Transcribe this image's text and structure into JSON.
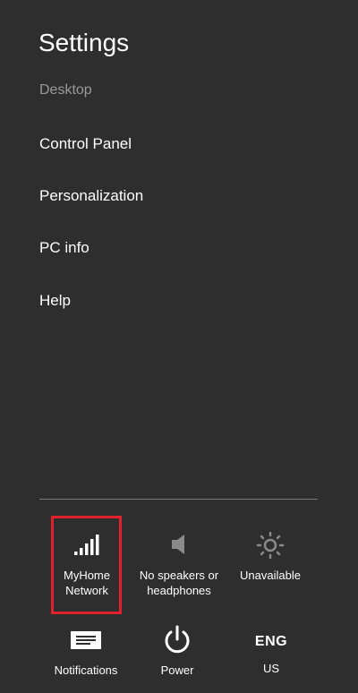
{
  "panel": {
    "title": "Settings",
    "subtitle": "Desktop"
  },
  "menu": {
    "items": [
      {
        "label": "Control Panel"
      },
      {
        "label": "Personalization"
      },
      {
        "label": "PC info"
      },
      {
        "label": "Help"
      }
    ]
  },
  "quick_settings": {
    "network": {
      "label": "MyHome\nNetwork",
      "icon": "signal-bars-icon"
    },
    "volume": {
      "label": "No speakers or\nheadphones",
      "icon": "speaker-muted-icon"
    },
    "brightness": {
      "label": "Unavailable",
      "icon": "brightness-icon"
    },
    "notifications": {
      "label": "Notifications",
      "icon": "notifications-icon"
    },
    "power": {
      "label": "Power",
      "icon": "power-icon"
    },
    "language": {
      "code": "ENG",
      "label": "US"
    }
  },
  "colors": {
    "background": "#2e2e2e",
    "highlight": "#e0202a",
    "muted_text": "#9a9a9a"
  }
}
